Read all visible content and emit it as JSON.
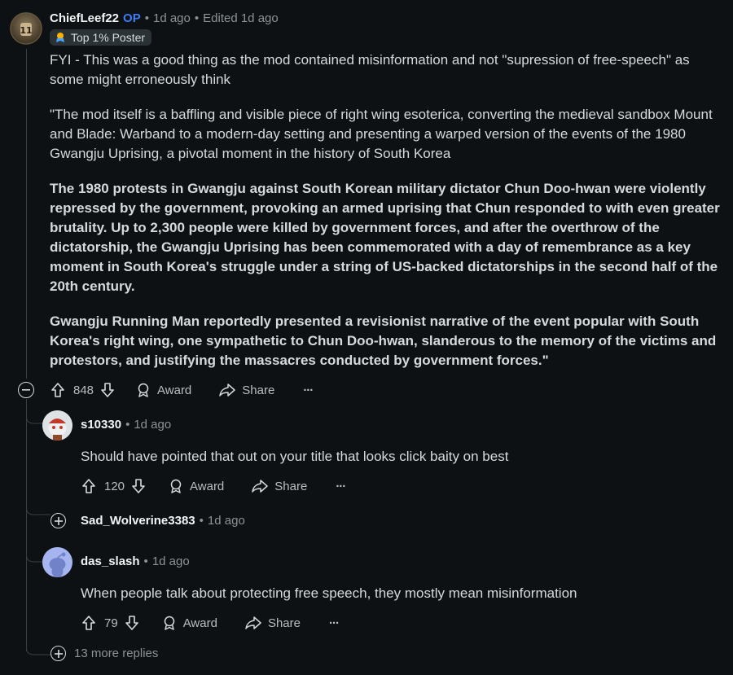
{
  "root_comment": {
    "username": "ChiefLeef22",
    "op_badge": "OP",
    "time": "1d ago",
    "edited": "Edited 1d ago",
    "flair": "Top 1% Poster",
    "paragraphs": [
      "FYI - This was a good thing as the mod contained misinformation and not \"supression of free-speech\" as some might erroneously think",
      "\"The mod itself is a baffling and visible piece of right wing esoterica, converting the medieval sandbox Mount and Blade: Warband to a modern-day setting and presenting a warped version of the events of the 1980 Gwangju Uprising, a pivotal moment in the history of South Korea",
      "The 1980 protests in Gwangju against South Korean military dictator Chun Doo-hwan were violently repressed by the government, provoking an armed uprising that Chun responded to with even greater brutality. Up to 2,300 people were killed by government forces, and after the overthrow of the dictatorship, the Gwangju Uprising has been commemorated with a day of remembrance as a key moment in South Korea's struggle under a string of US-backed dictatorships in the second half of the 20th century.",
      "Gwangju Running Man reportedly presented a revisionist narrative of the event popular with South Korea's right wing, one sympathetic to Chun Doo-hwan, slanderous to the memory of the victims and protestors, and justifying the massacres conducted by government forces.\""
    ],
    "score": "848",
    "award_label": "Award",
    "share_label": "Share",
    "more_label": "···"
  },
  "replies": [
    {
      "username": "s10330",
      "time": "1d ago",
      "text": "Should have pointed that out on your title that looks click baity on best",
      "score": "120",
      "award_label": "Award",
      "share_label": "Share",
      "more_label": "···"
    },
    {
      "username": "Sad_Wolverine3383",
      "time": "1d ago",
      "collapsed": true
    },
    {
      "username": "das_slash",
      "time": "1d ago",
      "text": "When people talk about protecting free speech, they mostly mean misinformation",
      "score": "79",
      "award_label": "Award",
      "share_label": "Share",
      "more_label": "···"
    }
  ],
  "more_replies": "13 more replies",
  "colors": {
    "background": "#0e1113",
    "text": "#d7dadc",
    "meta": "#8c9396",
    "op_blue": "#3d7df5",
    "thread_line": "#3a3f42"
  }
}
